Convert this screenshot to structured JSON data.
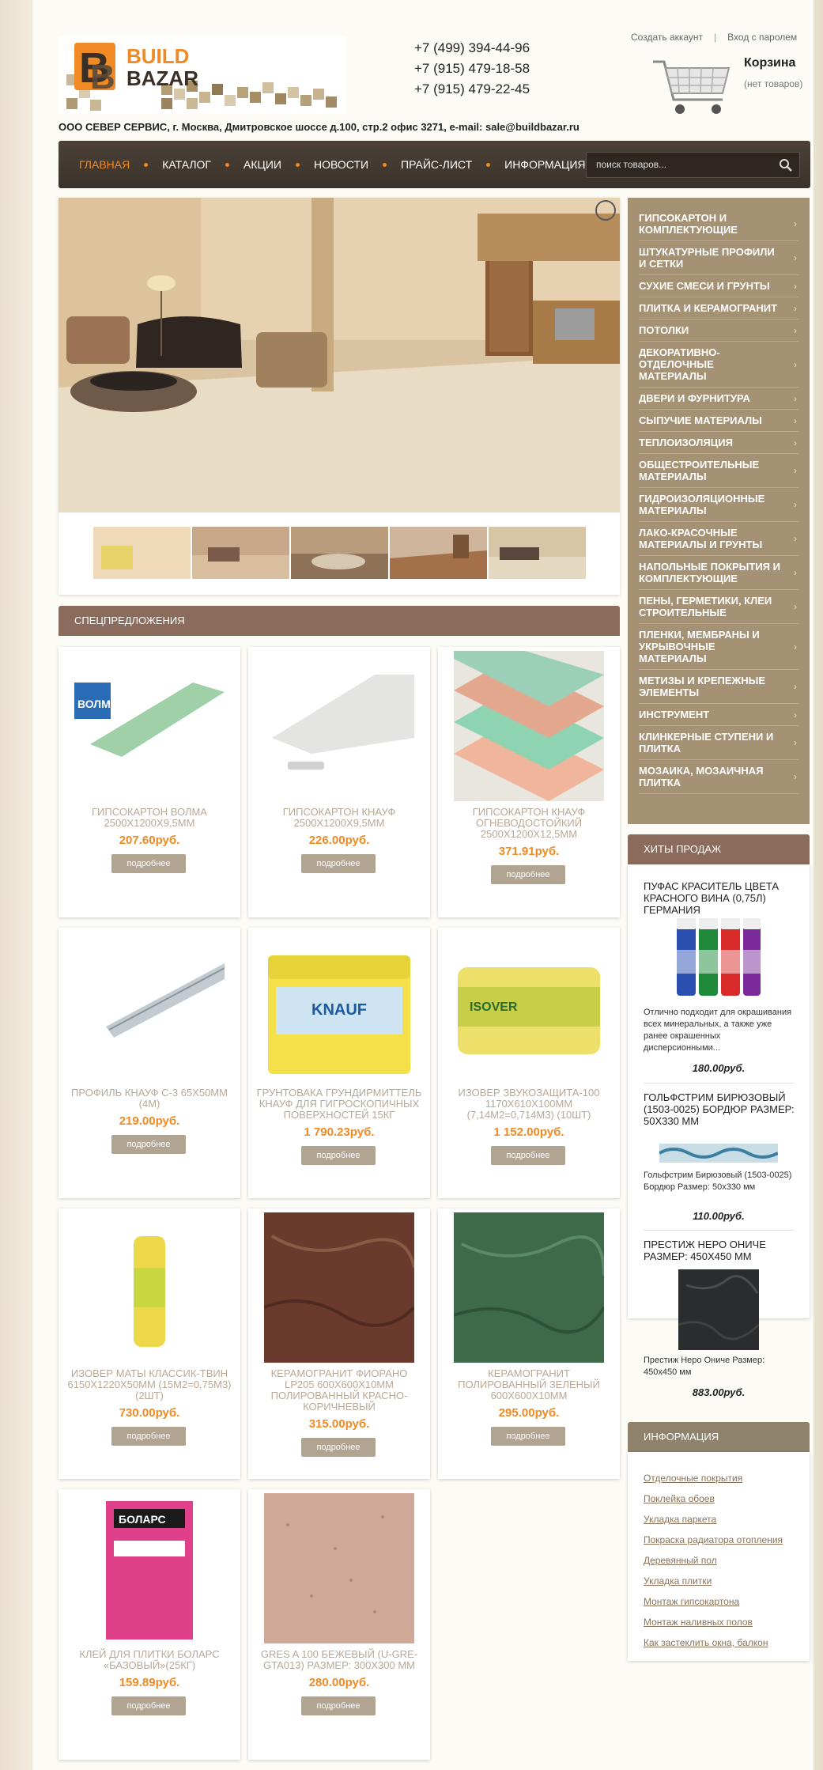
{
  "header": {
    "logo_text_1": "BUILD",
    "logo_text_2": "BAZAR",
    "phones": [
      "+7 (499) 394-44-96",
      "+7 (915) 479-18-58",
      "+7 (915) 479-22-45"
    ],
    "address": "ООО СЕВЕР СЕРВИС, г. Москва, Дмитровское шоссе д.100, стр.2 офис 3271, e-mail: sale@buildbazar.ru",
    "create_account": "Создать аккаунт",
    "login": "Вход с паролем",
    "cart_title": "Корзина",
    "cart_status": "(нет товаров)"
  },
  "nav": {
    "items": [
      "ГЛАВНАЯ",
      "КАТАЛОГ",
      "АКЦИИ",
      "НОВОСТИ",
      "ПРАЙС-ЛИСТ",
      "ИНФОРМАЦИЯ"
    ],
    "search_placeholder": "поиск товаров..."
  },
  "specials": {
    "title": "СПЕЦПРЕДЛОЖЕНИЯ",
    "more_label": "подробнее",
    "products": [
      {
        "name": "ГИПСОКАРТОН ВОЛМА 2500X1200X9,5ММ",
        "price": "207.60руб."
      },
      {
        "name": "ГИПСОКАРТОН КНАУФ 2500X1200X9,5ММ",
        "price": "226.00руб."
      },
      {
        "name": "ГИПСОКАРТОН КНАУФ ОГНЕВОДОСТОЙКИЙ 2500Х1200Х12,5ММ",
        "price": "371.91руб."
      },
      {
        "name": "ПРОФИЛЬ КНАУФ С-3 65Х50ММ (4М)",
        "price": "219.00руб."
      },
      {
        "name": "ГРУНТОВАКА ГРУНДИРМИТТЕЛЬ КНАУФ ДЛЯ ГИГРОСКОПИЧНЫХ ПОВЕРХНОСТЕЙ 15КГ",
        "price": "1 790.23руб."
      },
      {
        "name": "ИЗОВЕР ЗВУКОЗАЩИТА-100 1170Х610Х100ММ (7,14М2=0,714М3) (10ШТ)",
        "price": "1 152.00руб."
      },
      {
        "name": "ИЗОВЕР МАТЫ КЛАССИК-ТВИН 6150Х1220Х50ММ (15М2=0,75М3) (2ШТ)",
        "price": "730.00руб."
      },
      {
        "name": "КЕРАМОГРАНИТ ФИОРАНО LP205 600Х600Х10ММ ПОЛИРОВАННЫЙ КРАСНО-КОРИЧНЕВЫЙ",
        "price": "315.00руб."
      },
      {
        "name": "КЕРАМОГРАНИТ ПОЛИРОВАННЫЙ ЗЕЛЕНЫЙ 600Х600Х10ММ",
        "price": "295.00руб."
      },
      {
        "name": "КЛЕЙ ДЛЯ ПЛИТКИ БОЛАРС «БАЗОВЫЙ»(25КГ)",
        "price": "159.89руб."
      },
      {
        "name": "GRES A 100 БЕЖЕВЫЙ (U-GRE-GTA013) РАЗМЕР: 300X300 ММ",
        "price": "280.00руб."
      }
    ]
  },
  "categories": [
    "ГИПСОКАРТОН И КОМПЛЕКТУЮЩИЕ",
    "ШТУКАТУРНЫЕ ПРОФИЛИ И СЕТКИ",
    "СУХИЕ СМЕСИ И ГРУНТЫ",
    "ПЛИТКА И КЕРАМОГРАНИТ",
    "ПОТОЛКИ",
    "ДЕКОРАТИВНО-ОТДЕЛОЧНЫЕ МАТЕРИАЛЫ",
    "ДВЕРИ И ФУРНИТУРА",
    "СЫПУЧИЕ МАТЕРИАЛЫ",
    "ТЕПЛОИЗОЛЯЦИЯ",
    "ОБЩЕСТРОИТЕЛЬНЫЕ МАТЕРИАЛЫ",
    "ГИДРОИЗОЛЯЦИОННЫЕ МАТЕРИАЛЫ",
    "ЛАКО-КРАСОЧНЫЕ МАТЕРИАЛЫ И ГРУНТЫ",
    "НАПОЛЬНЫЕ ПОКРЫТИЯ И КОМПЛЕКТУЮЩИЕ",
    "ПЕНЫ, ГЕРМЕТИКИ, КЛЕИ СТРОИТЕЛЬНЫЕ",
    "ПЛЕНКИ, МЕМБРАНЫ И УКРЫВОЧНЫЕ МАТЕРИАЛЫ",
    "МЕТИЗЫ И КРЕПЕЖНЫЕ ЭЛЕМЕНТЫ",
    "ИНСТРУМЕНТ",
    "КЛИНКЕРНЫЕ СТУПЕНИ И ПЛИТКА",
    "МОЗАИКА, МОЗАИЧНАЯ ПЛИТКА"
  ],
  "hits": {
    "title": "ХИТЫ ПРОДАЖ",
    "items": [
      {
        "name": "ПУФАС КРАСИТЕЛЬ ЦВЕТА КРАСНОГО ВИНА (0,75Л) ГЕРМАНИЯ",
        "desc": "Отлично подходит для окрашивания всех минеральных, а также уже ранее окрашенных дисперсионными...",
        "price": "180.00руб."
      },
      {
        "name": "ГОЛЬФСТРИМ БИРЮЗОВЫЙ (1503-0025) БОРДЮР РАЗМЕР: 50X330 ММ",
        "desc": "Гольфстрим Бирюзовый (1503-0025) Бордюр Размер: 50x330 мм",
        "price": "110.00руб."
      },
      {
        "name": "ПРЕСТИЖ НЕРО ОНИЧЕ РАЗМЕР: 450X450 ММ",
        "desc": "Престиж Неро Ониче Размер: 450x450 мм",
        "price": "883.00руб."
      }
    ]
  },
  "info": {
    "title": "ИНФОРМАЦИЯ",
    "links": [
      "Отделочные покрытия",
      "Поклейка обоев",
      "Укладка паркета",
      "Покраска радиатора отопления",
      "Деревянный пол",
      "Укладка плитки",
      "Монтаж гипсокартона",
      "Монтаж наливных полов",
      "Как застеклить окна, балкон"
    ]
  },
  "colors": {
    "accent_orange": "#f08a24",
    "nav_bg": "#3a322a",
    "sidebar_bg": "#a59274",
    "header_brown": "#8b6b5c"
  }
}
